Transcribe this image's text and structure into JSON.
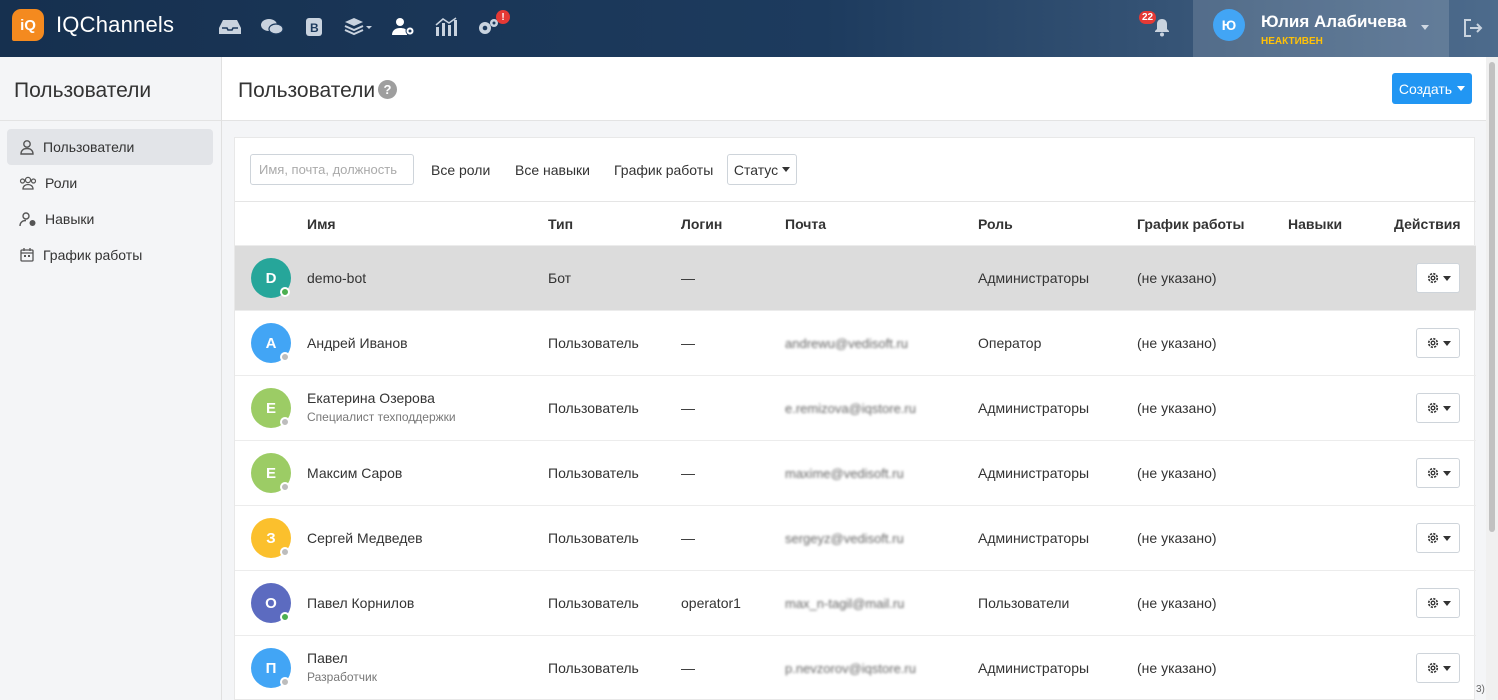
{
  "app": {
    "logo_badge": "iQ",
    "brand": "IQChannels",
    "nav_icons": [
      "inbox-icon",
      "chats-icon",
      "bots-icon",
      "layers-icon",
      "users-settings-icon",
      "analytics-icon",
      "settings-icon"
    ],
    "settings_alert": "!",
    "notifications_count": "22",
    "user": {
      "initial": "Ю",
      "name": "Юлия Алабичева",
      "status": "НЕАКТИВЕН"
    }
  },
  "sidebar": {
    "title": "Пользователи",
    "items": [
      {
        "label": "Пользователи",
        "icon": "user-icon",
        "active": true
      },
      {
        "label": "Роли",
        "icon": "group-icon",
        "active": false
      },
      {
        "label": "Навыки",
        "icon": "user-skill-icon",
        "active": false
      },
      {
        "label": "График работы",
        "icon": "calendar-icon",
        "active": false
      }
    ]
  },
  "main": {
    "title": "Пользователи",
    "help": "?",
    "create_label": "Создать",
    "filters": {
      "search_placeholder": "Имя, почта, должность",
      "roles": "Все роли",
      "skills": "Все навыки",
      "schedule": "График работы",
      "status": "Статус"
    },
    "columns": {
      "name": "Имя",
      "type": "Тип",
      "login": "Логин",
      "email": "Почта",
      "role": "Роль",
      "schedule": "График работы",
      "skills": "Навыки",
      "actions": "Действия"
    },
    "rows": [
      {
        "initial": "D",
        "color": "#26a69a",
        "online": true,
        "name": "demo-bot",
        "subtitle": "",
        "type": "Бот",
        "login": "—",
        "email": "",
        "role": "Администраторы",
        "schedule": "(не указано)"
      },
      {
        "initial": "А",
        "color": "#42a5f5",
        "online": false,
        "name": "Андрей Иванов",
        "subtitle": "",
        "type": "Пользователь",
        "login": "—",
        "email": "andrewu@vedisoft.ru",
        "role": "Оператор",
        "schedule": "(не указано)"
      },
      {
        "initial": "Е",
        "color": "#9ccc65",
        "online": false,
        "name": "Екатерина Озерова",
        "subtitle": "Специалист техподдержки",
        "type": "Пользователь",
        "login": "—",
        "email": "e.remizova@iqstore.ru",
        "role": "Администраторы",
        "schedule": "(не указано)"
      },
      {
        "initial": "Е",
        "color": "#9ccc65",
        "online": false,
        "name": "Максим Саров",
        "subtitle": "",
        "type": "Пользователь",
        "login": "—",
        "email": "maxime@vedisoft.ru",
        "role": "Администраторы",
        "schedule": "(не указано)"
      },
      {
        "initial": "З",
        "color": "#fbc02d",
        "online": false,
        "name": "Сергей Медведев",
        "subtitle": "",
        "type": "Пользователь",
        "login": "—",
        "email": "sergeyz@vedisoft.ru",
        "role": "Администраторы",
        "schedule": "(не указано)"
      },
      {
        "initial": "О",
        "color": "#5c6bc0",
        "online": true,
        "name": "Павел Корнилов",
        "subtitle": "",
        "type": "Пользователь",
        "login": "operator1",
        "email": "max_n-tagil@mail.ru",
        "role": "Пользователи",
        "schedule": "(не указано)"
      },
      {
        "initial": "П",
        "color": "#42a5f5",
        "online": false,
        "name": "Павел",
        "subtitle": "Разработчик",
        "type": "Пользователь",
        "login": "—",
        "email": "p.nevzorov@iqstore.ru",
        "role": "Администраторы",
        "schedule": "(не указано)"
      }
    ],
    "corner_note": "3)"
  }
}
